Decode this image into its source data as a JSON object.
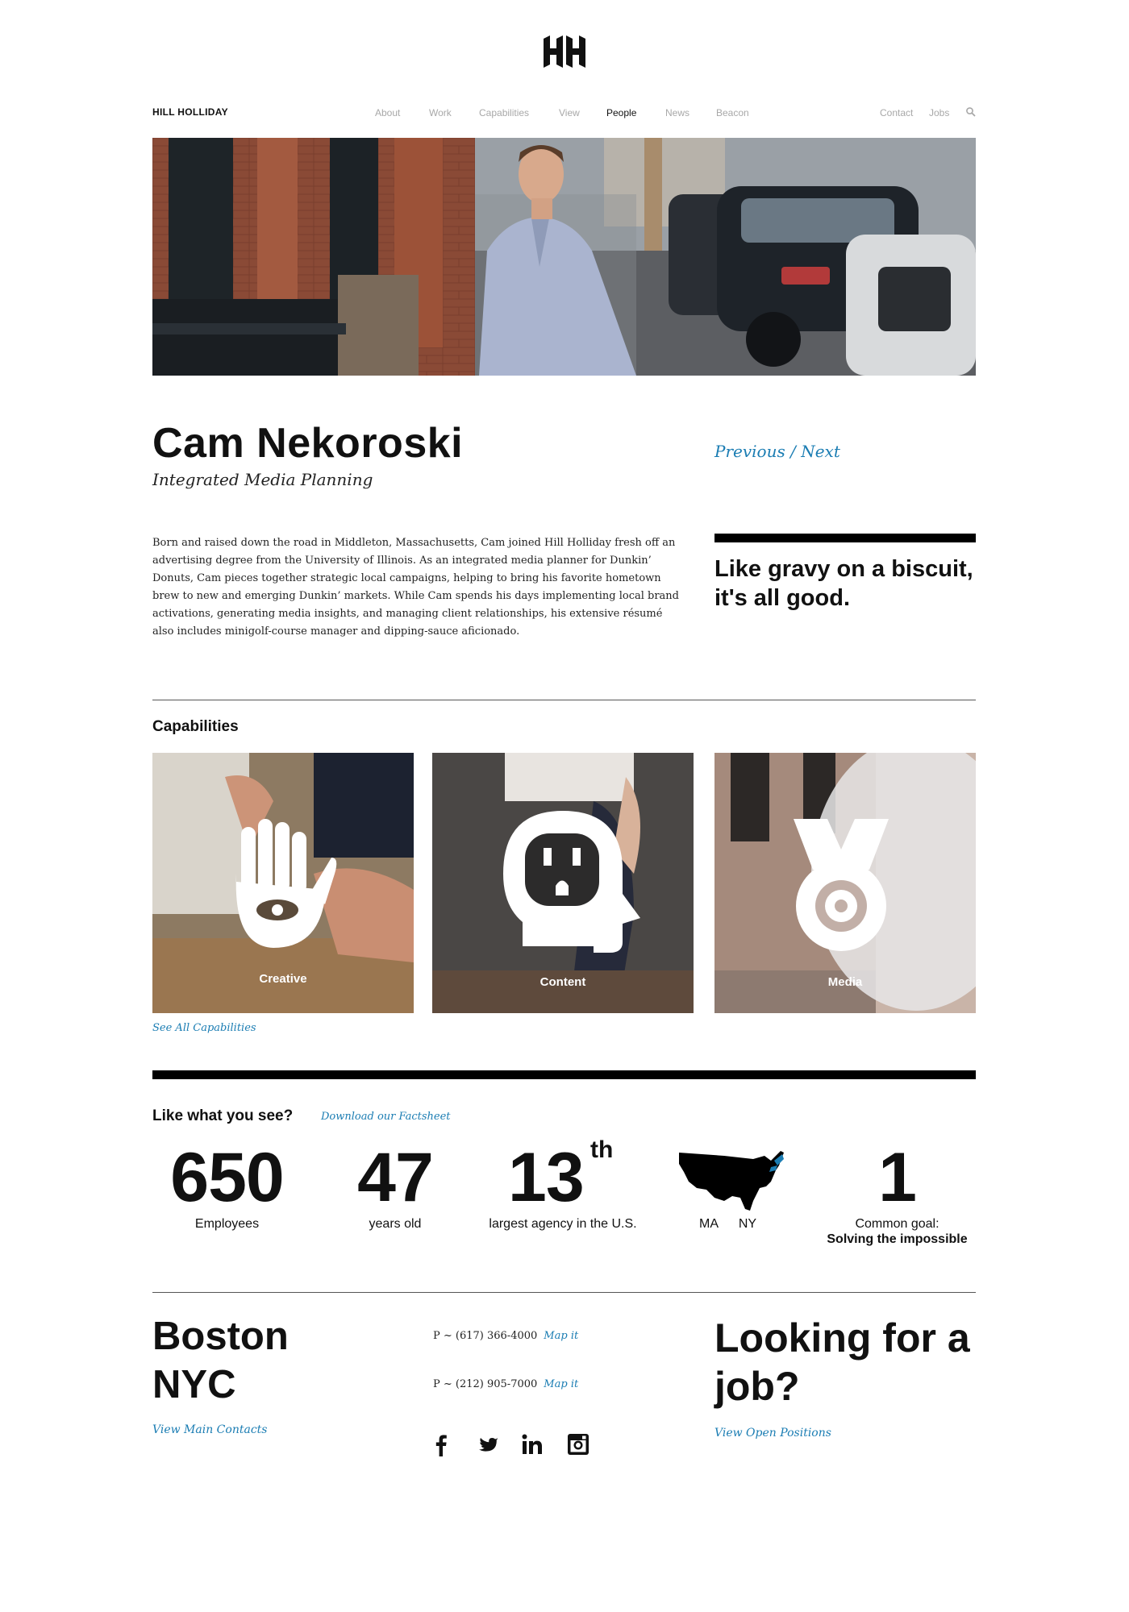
{
  "header": {
    "brand": "HILL HOLLIDAY",
    "nav": [
      "About",
      "Work",
      "Capabilities",
      "View",
      "People",
      "News",
      "Beacon"
    ],
    "active_nav": "People",
    "utility_nav": [
      "Contact",
      "Jobs"
    ]
  },
  "person": {
    "name": "Cam Nekoroski",
    "title": "Integrated Media Planning",
    "previous": "Previous",
    "separator": "/",
    "next": "Next",
    "bio": "Born and raised down the road in Middleton, Massachusetts, Cam joined Hill Holliday fresh off an advertising degree from the University of Illinois. As an integrated media planner for Dunkin’ Donuts, Cam pieces together strategic local campaigns, helping to bring his favorite hometown brew to new and emerging Dunkin’ markets. While Cam spends his days implementing local brand activations, generating media insights, and managing client relationships, his extensive résumé also includes minigolf-course manager and dipping-sauce aficionado.",
    "quote": "Like gravy on a biscuit, it's all good."
  },
  "capabilities": {
    "heading": "Capabilities",
    "items": [
      {
        "label": "Creative",
        "icon": "hand-eye-icon"
      },
      {
        "label": "Content",
        "icon": "head-outlet-icon"
      },
      {
        "label": "Media",
        "icon": "target-icon"
      }
    ],
    "see_all": "See All Capabilities"
  },
  "stats": {
    "heading": "Like what you see?",
    "factsheet": "Download our Factsheet",
    "employees_value": "650",
    "employees_label": "Employees",
    "years_value": "47",
    "years_label": "years old",
    "rank_value": "13",
    "rank_suffix": "th",
    "rank_label": "largest agency in the U.S.",
    "state_1": "MA",
    "state_2": "NY",
    "goal_value": "1",
    "goal_label": "Common goal:",
    "goal_bold": "Solving the impossible"
  },
  "footer": {
    "city_1": "Boston",
    "city_2": "NYC",
    "view_contacts": "View Main Contacts",
    "phone_1": "P ~ (617) 366-4000",
    "phone_2": "P ~ (212) 905-7000",
    "map_it": "Map it",
    "social": [
      "facebook-icon",
      "twitter-icon",
      "linkedin-icon",
      "instagram-icon"
    ],
    "job_heading": "Looking for a job?",
    "open_positions": "View Open Positions"
  },
  "colors": {
    "link": "#1b7db3",
    "nav_inactive": "#a8a8a8",
    "text": "#111111"
  }
}
